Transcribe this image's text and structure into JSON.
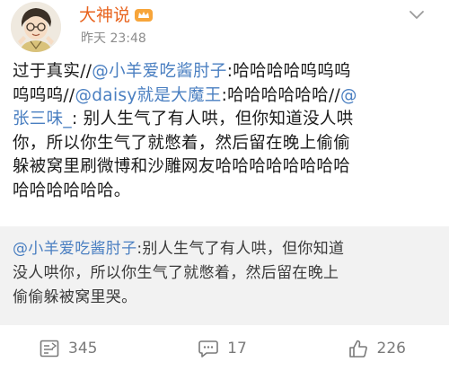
{
  "post": {
    "author": "大神说",
    "time": "昨天 23:48",
    "lines": [
      [
        {
          "text": "过于真实//"
        },
        {
          "text": "@小羊爱吃酱肘子",
          "mention": true
        },
        {
          "text": ":哈哈哈哈呜呜呜"
        }
      ],
      [
        {
          "text": "呜呜呜//"
        },
        {
          "text": "@daisy就是大魔王",
          "mention": true
        },
        {
          "text": ":哈哈哈哈哈哈//"
        },
        {
          "text": "@",
          "mention": true
        }
      ],
      [
        {
          "text": "张三味_",
          "mention": true
        },
        {
          "text": ": 别人生气了有人哄，但你知道没人哄"
        }
      ],
      [
        {
          "text": "你，所以你生气了就憋着，然后留在晚上偷偷"
        }
      ],
      [
        {
          "text": "躲被窝里刷微博和沙雕网友哈哈哈哈哈哈哈哈"
        }
      ],
      [
        {
          "text": "哈哈哈哈哈哈。"
        }
      ]
    ]
  },
  "repost": {
    "lines": [
      [
        {
          "text": "@小羊爱吃酱肘子",
          "mention": true
        },
        {
          "text": ":别人生气了有人哄，但你知道"
        }
      ],
      [
        {
          "text": "没人哄你，所以你生气了就憋着，然后留在晚上"
        }
      ],
      [
        {
          "text": "偷偷躲被窝里哭。"
        }
      ]
    ]
  },
  "actions": {
    "reposts": "345",
    "comments": "17",
    "likes": "226"
  },
  "colors": {
    "author": "#e8641f",
    "mention": "#4a7fc1",
    "repost_bg": "#f2f2f2",
    "meta": "#8c8c8c"
  }
}
